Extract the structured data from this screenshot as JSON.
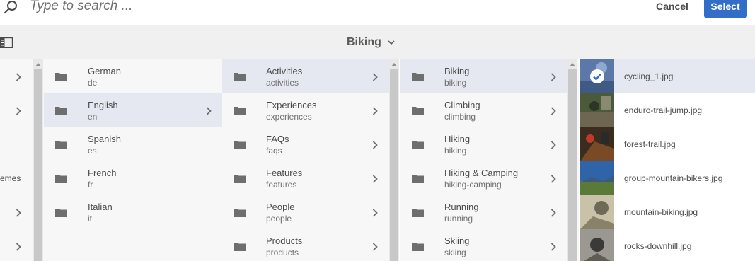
{
  "search": {
    "placeholder": "Type to search ..."
  },
  "toolbar": {
    "cancel_label": "Cancel",
    "select_label": "Select"
  },
  "breadcrumb": {
    "title": "Biking"
  },
  "column0": {
    "items": [
      {
        "label": ""
      },
      {
        "label": ""
      },
      {
        "label": ""
      },
      {
        "label": "emes"
      },
      {
        "label": ""
      },
      {
        "label": ""
      }
    ]
  },
  "column1": {
    "items": [
      {
        "title": "German",
        "sub": "de"
      },
      {
        "title": "English",
        "sub": "en"
      },
      {
        "title": "Spanish",
        "sub": "es"
      },
      {
        "title": "French",
        "sub": "fr"
      },
      {
        "title": "Italian",
        "sub": "it"
      }
    ]
  },
  "column2": {
    "items": [
      {
        "title": "Activities",
        "sub": "activities"
      },
      {
        "title": "Experiences",
        "sub": "experiences"
      },
      {
        "title": "FAQs",
        "sub": "faqs"
      },
      {
        "title": "Features",
        "sub": "features"
      },
      {
        "title": "People",
        "sub": "people"
      },
      {
        "title": "Products",
        "sub": "products"
      }
    ]
  },
  "column3": {
    "items": [
      {
        "title": "Biking",
        "sub": "biking"
      },
      {
        "title": "Climbing",
        "sub": "climbing"
      },
      {
        "title": "Hiking",
        "sub": "hiking"
      },
      {
        "title": "Hiking & Camping",
        "sub": "hiking-camping"
      },
      {
        "title": "Running",
        "sub": "running"
      },
      {
        "title": "Skiing",
        "sub": "skiing"
      }
    ]
  },
  "assets": {
    "items": [
      {
        "name": "cycling_1.jpg"
      },
      {
        "name": "enduro-trail-jump.jpg"
      },
      {
        "name": "forest-trail.jpg"
      },
      {
        "name": "group-mountain-bikers.jpg"
      },
      {
        "name": "mountain-biking.jpg"
      },
      {
        "name": "rocks-downhill.jpg"
      }
    ]
  },
  "icons": {
    "search": "search-icon",
    "rail": "rail-toggle-icon",
    "folder": "folder-icon",
    "chevron": "chevron-right-icon",
    "check": "check-icon"
  },
  "colors": {
    "accent": "#326ec8",
    "selected_row": "#e5e8f1",
    "column_bg": "#f7f7f7",
    "titlebar_bg": "#f0f0f0"
  }
}
